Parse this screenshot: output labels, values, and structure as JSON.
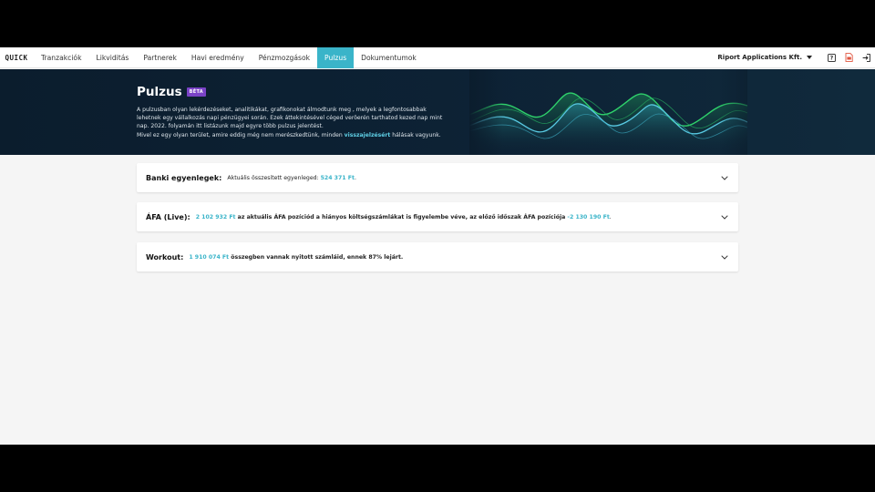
{
  "nav": {
    "logo": "QUICK",
    "items": [
      {
        "label": "Tranzakciók"
      },
      {
        "label": "Likviditás"
      },
      {
        "label": "Partnerek"
      },
      {
        "label": "Havi eredmény"
      },
      {
        "label": "Pénzmozgások"
      },
      {
        "label": "Pulzus"
      },
      {
        "label": "Dokumentumok"
      }
    ],
    "active_item": "Pulzus",
    "company": "Riport Applications Kft.",
    "icons": [
      "help-icon",
      "document-icon",
      "logout-icon"
    ]
  },
  "hero": {
    "title": "Pulzus",
    "badge": "BÉTA",
    "line1": "A pulzusban olyan lekérdezéseket, analitikákat, grafikonokat álmodtunk meg , melyek a legfontosabbak lehetnek egy vállalkozás napi pénzügyei során. Ezek áttekintésével céged veröerén tarthatod kezed nap mint nap. 2022. folyamán itt listázunk majd egyre több pulzus jelentést.",
    "line2_pre": "Mivel ez egy olyan terület, amire eddig még nem merészkedtünk, minden ",
    "line2_link": "visszajelzésért",
    "line2_post": " hálásak vagyunk."
  },
  "cards": [
    {
      "label": "Banki egyenlegek:",
      "text_pre": "Aktuális összesített egyenleged: ",
      "value": "524 371 Ft",
      "text_post": "."
    },
    {
      "label": "ÁFA (Live):",
      "value": "2 102 932 Ft",
      "text_mid": " az aktuális ÁFA pozíciód a hiányos költségszámlákat is figyelembe véve, az előző időszak ÁFA pozíciója ",
      "value2": "-2 130 190 Ft",
      "text_post": "."
    },
    {
      "label": "Workout:",
      "value": "1 910 074 Ft",
      "text_mid": " összegben vannak nyitott számláid, ennek 87% lejárt."
    }
  ],
  "colors": {
    "accent": "#3ab4c9",
    "hero_bg": "#0b1d2d",
    "badge": "#7b43c7",
    "wave_green": "#2fd16b",
    "wave_cyan": "#58c9e2"
  }
}
